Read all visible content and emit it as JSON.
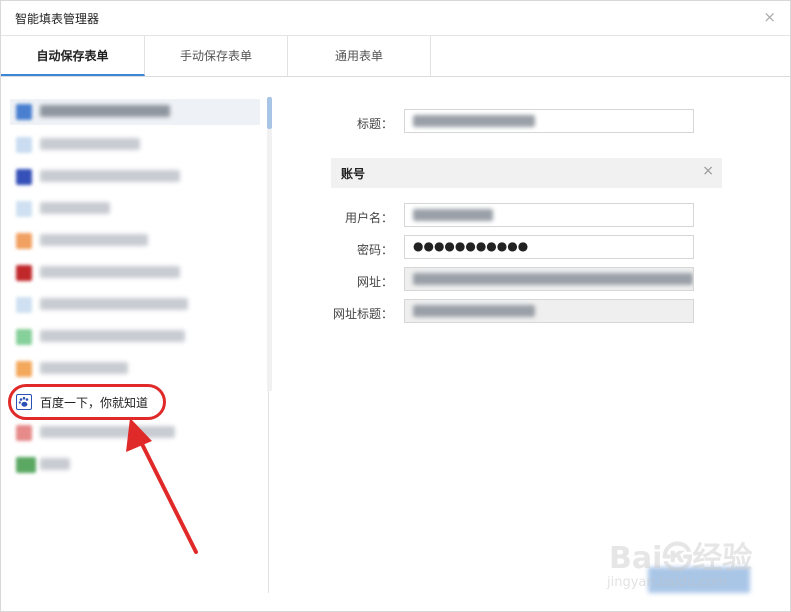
{
  "window": {
    "title": "智能填表管理器",
    "close_glyph": "×"
  },
  "tabs": [
    {
      "label": "自动保存表单",
      "active": true
    },
    {
      "label": "手动保存表单",
      "active": false
    },
    {
      "label": "通用表单",
      "active": false
    }
  ],
  "sidebar": {
    "highlighted_item": {
      "label": "百度一下，你就知道",
      "icon": "baidu-paw-icon"
    }
  },
  "detail": {
    "title_label": "标题：",
    "section": {
      "title": "账号",
      "close_glyph": "×"
    },
    "username_label": "用户名：",
    "password_label": "密码：",
    "password_mask": "●●●●●●●●●●●",
    "url_label": "网址：",
    "url_title_label": "网址标题："
  },
  "watermark": {
    "main": "Bai㉿经验",
    "sub": "jingyan.baidu.com"
  },
  "colors": {
    "accent": "#3a86d8",
    "annotation": "#e02a2a"
  }
}
